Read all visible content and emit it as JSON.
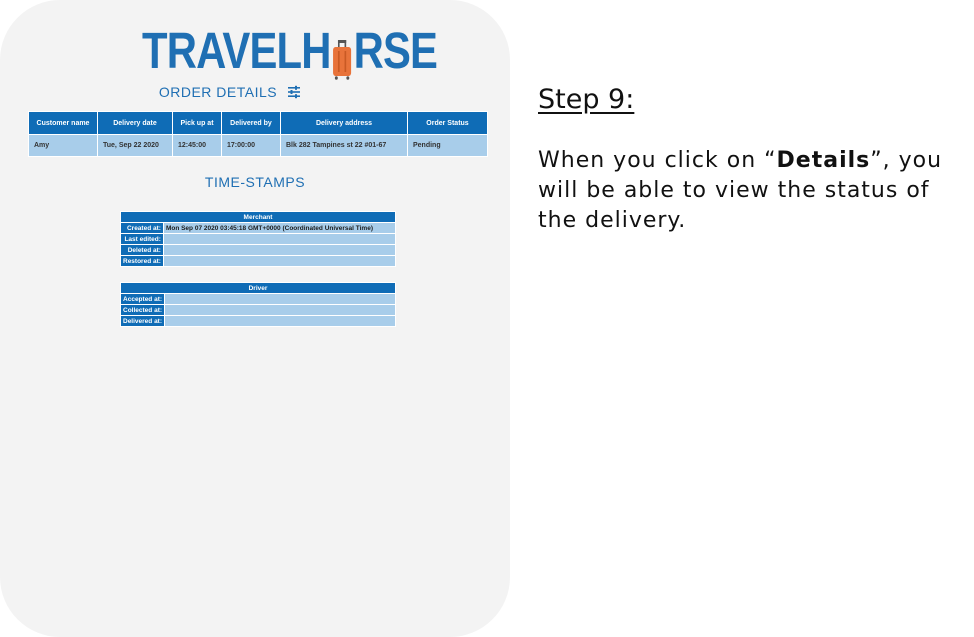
{
  "logo": {
    "text_left": "TRAVELH",
    "text_right": "RSE",
    "suitcase_color": "#e8733a"
  },
  "order_details": {
    "title": "ORDER DETAILS",
    "icon": "filter-sliders-icon",
    "columns": [
      "Customer name",
      "Delivery date",
      "Pick up at",
      "Delivered by",
      "Delivery address",
      "Order Status"
    ],
    "row": [
      "Amy",
      "Tue, Sep 22 2020",
      "12:45:00",
      "17:00:00",
      "Blk 282 Tampines st 22 #01-67",
      "Pending"
    ]
  },
  "timestamps": {
    "title": "TIME-STAMPS",
    "merchant": {
      "header": "Merchant",
      "rows": [
        {
          "label": "Created at:",
          "value": "Mon Sep 07 2020 03:45:18 GMT+0000 (Coordinated Universal Time)"
        },
        {
          "label": "Last edited:",
          "value": ""
        },
        {
          "label": "Deleted at:",
          "value": ""
        },
        {
          "label": "Restored at:",
          "value": ""
        }
      ]
    },
    "driver": {
      "header": "Driver",
      "rows": [
        {
          "label": "Accepted at:",
          "value": ""
        },
        {
          "label": "Collected at:",
          "value": ""
        },
        {
          "label": "Delivered at:",
          "value": ""
        }
      ]
    }
  },
  "instruction": {
    "step": "Step 9:",
    "text_before": "When you click on “",
    "text_bold": "Details",
    "text_after": "”, you will be able to view the status of the delivery."
  },
  "colors": {
    "brand_blue": "#1f6fb3",
    "header_blue": "#0f6cb6",
    "cell_blue": "#a8cdea",
    "panel_bg": "#f3f3f3"
  }
}
